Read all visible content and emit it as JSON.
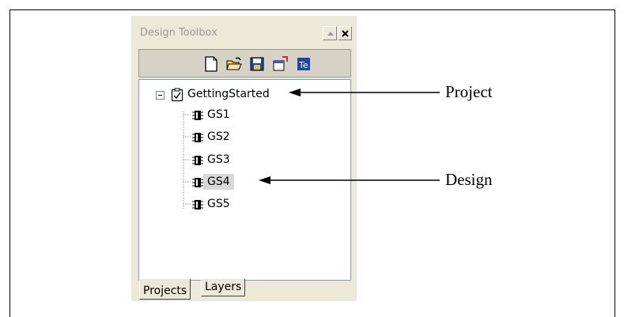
{
  "window": {
    "title": "Design Toolbox"
  },
  "toolbar": {
    "tools": [
      "new-document-icon",
      "open-folder-icon",
      "save-icon",
      "export-icon",
      "text-editor-icon"
    ]
  },
  "tree": {
    "project_label": "GettingStarted",
    "designs": [
      "GS1",
      "GS2",
      "GS3",
      "GS4",
      "GS5"
    ],
    "selected": "GS4"
  },
  "tabs": {
    "projects": "Projects",
    "layers": "Layers"
  },
  "callouts": {
    "project": "Project",
    "design": "Design"
  }
}
